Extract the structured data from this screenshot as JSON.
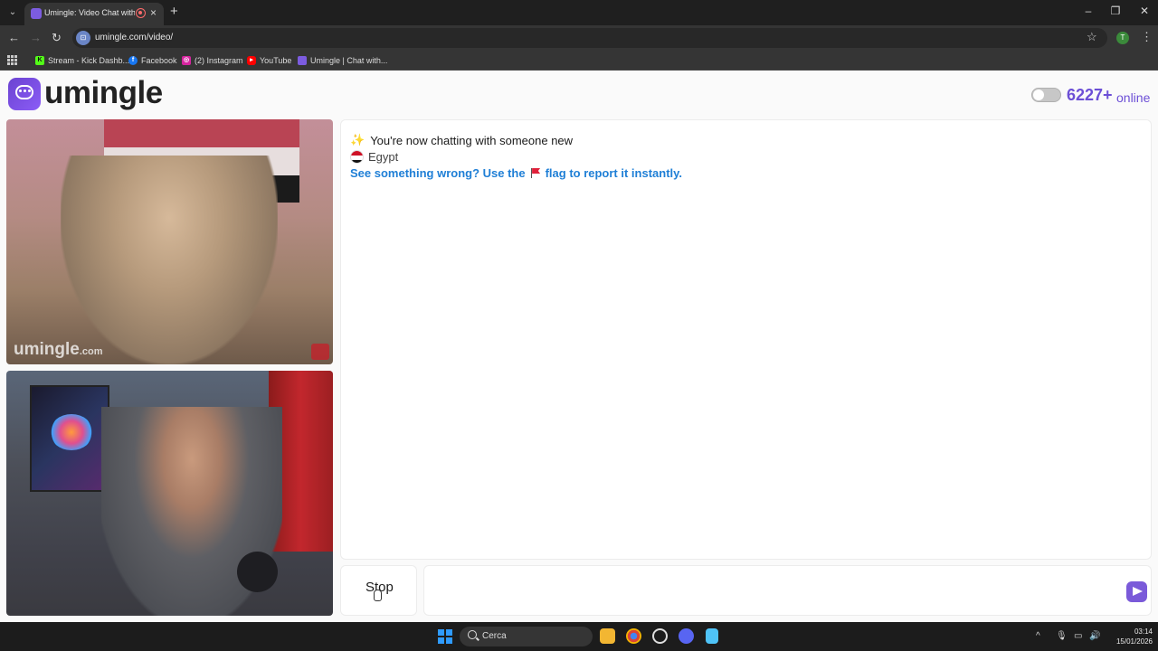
{
  "browser": {
    "tab_title": "Umingle: Video Chat with S",
    "tab_close": "×",
    "new_tab": "+",
    "url": "umingle.com/video/",
    "profile_initial": "T",
    "bookmarks": [
      {
        "label": "Stream - Kick Dashb...",
        "icon": "kick-icon",
        "color": "#53fc18"
      },
      {
        "label": "Facebook",
        "icon": "facebook-icon",
        "color": "#1877f2"
      },
      {
        "label": "(2) Instagram",
        "icon": "instagram-icon",
        "color": "#d6249f"
      },
      {
        "label": "YouTube",
        "icon": "youtube-icon",
        "color": "#ff0000"
      },
      {
        "label": "Umingle | Chat with...",
        "icon": "umingle-icon",
        "color": "#7c5ce0"
      }
    ]
  },
  "header": {
    "logo_text": "umingle",
    "online_count": "6227+",
    "online_label": "online"
  },
  "video": {
    "watermark": "umingle",
    "watermark_suffix": ".com"
  },
  "chat": {
    "welcome": "You're now chatting with someone new",
    "country": "Egypt",
    "report_prefix": "See something wrong? Use the",
    "report_suffix": "flag to report it instantly."
  },
  "controls": {
    "stop_label": "Stop",
    "message_placeholder": ""
  },
  "taskbar": {
    "search_label": "Cerca",
    "time": "03:14",
    "date": "15/01/2026"
  },
  "colors": {
    "brand": "#6c4fd6",
    "link": "#1f7fd6"
  }
}
